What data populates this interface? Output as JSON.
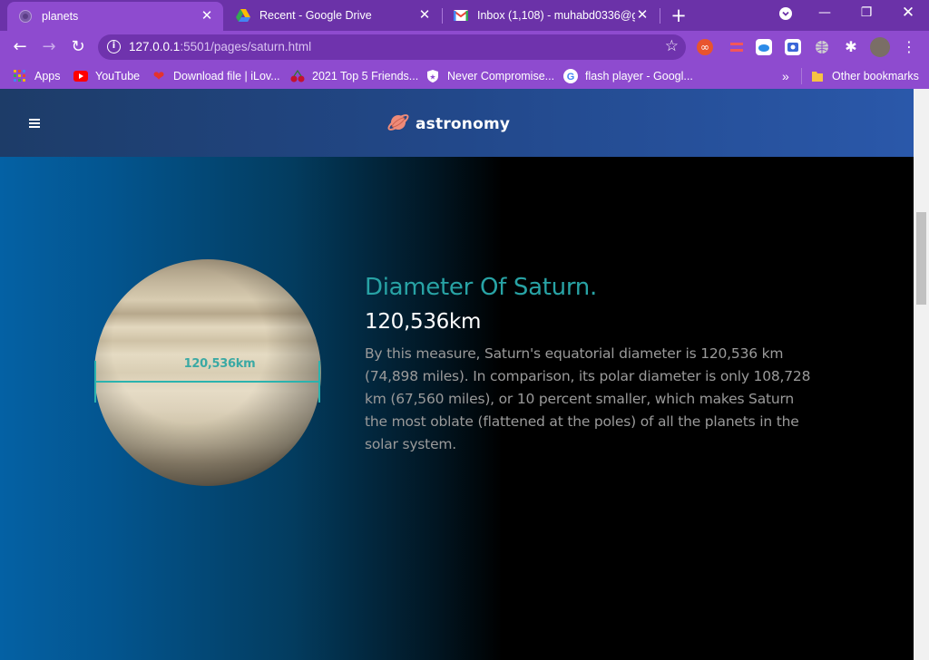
{
  "browser": {
    "tabs": [
      {
        "title": "planets",
        "active": true
      },
      {
        "title": "Recent - Google Drive",
        "active": false
      },
      {
        "title": "Inbox (1,108) - muhabd0336@gm",
        "active": false
      }
    ],
    "url_host": "127.0.0.1",
    "url_rest": ":5501/pages/saturn.html",
    "bookmarks": [
      {
        "label": "Apps",
        "icon": "apps-grid-icon"
      },
      {
        "label": "YouTube",
        "icon": "youtube-icon"
      },
      {
        "label": "Download file | iLov...",
        "icon": "ilovepdf-heart-icon"
      },
      {
        "label": "2021 Top 5 Friends...",
        "icon": "cherries-icon"
      },
      {
        "label": "Never Compromise...",
        "icon": "shield-star-icon"
      },
      {
        "label": "flash player - Googl...",
        "icon": "google-g-icon"
      }
    ],
    "more_bookmarks": "»",
    "other_bookmarks": "Other bookmarks"
  },
  "site": {
    "brand": "astronomy",
    "section": {
      "heading": "Diameter Of Saturn.",
      "value": "120,536km",
      "diagram_label": "120,536km",
      "description": "By this measure, Saturn's equatorial diameter is 120,536 km (74,898 miles). In comparison, its polar diameter is only 108,728 km (67,560 miles), or 10 percent smaller, which makes Saturn the most oblate (flattened at the poles) of all the planets in the solar system."
    }
  },
  "colors": {
    "chrome_tabstrip": "#6b32a8",
    "chrome_toolbar": "#8e4bcf",
    "heading_teal": "#28a3a5",
    "measure_teal": "#2bb3ae"
  }
}
